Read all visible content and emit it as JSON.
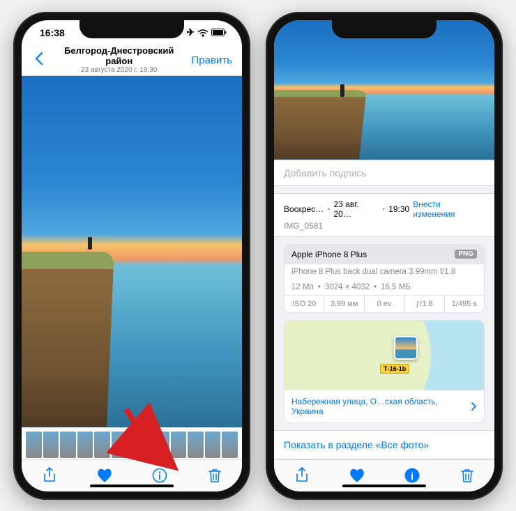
{
  "left": {
    "status_time": "16:38",
    "nav": {
      "title": "Белгород-Днестровский район",
      "subtitle": "23 августа 2020 г.  19:30",
      "edit": "Править"
    }
  },
  "right": {
    "caption_placeholder": "Добавить подпись",
    "date_row": {
      "day": "Воскрес…",
      "date": "23 авг. 20…",
      "time": "19:30",
      "adjust": "Внести изменения"
    },
    "filename": "IMG_0581",
    "exif": {
      "device": "Apple iPhone 8 Plus",
      "badge": "PNG",
      "lens": "iPhone 8 Plus back dual camera 3.99mm f/1.8",
      "mp": "12 Мп",
      "dims": "3024 × 4032",
      "size": "16,5 МБ",
      "iso": "ISO 20",
      "focal": "3,99 мм",
      "ev": "0 ev",
      "aperture": "ƒ/1.8",
      "shutter": "1/495 s"
    },
    "map": {
      "road": "Т-16-1b",
      "address": "Набережная улица, О…ская область, Украина"
    },
    "show_in_all": "Показать в разделе «Все фото»"
  },
  "icons": {
    "back": "chevron-left",
    "share": "share",
    "heart": "heart",
    "info": "info-circle",
    "trash": "trash",
    "airplane": "airplane",
    "wifi": "wifi",
    "battery": "battery"
  }
}
